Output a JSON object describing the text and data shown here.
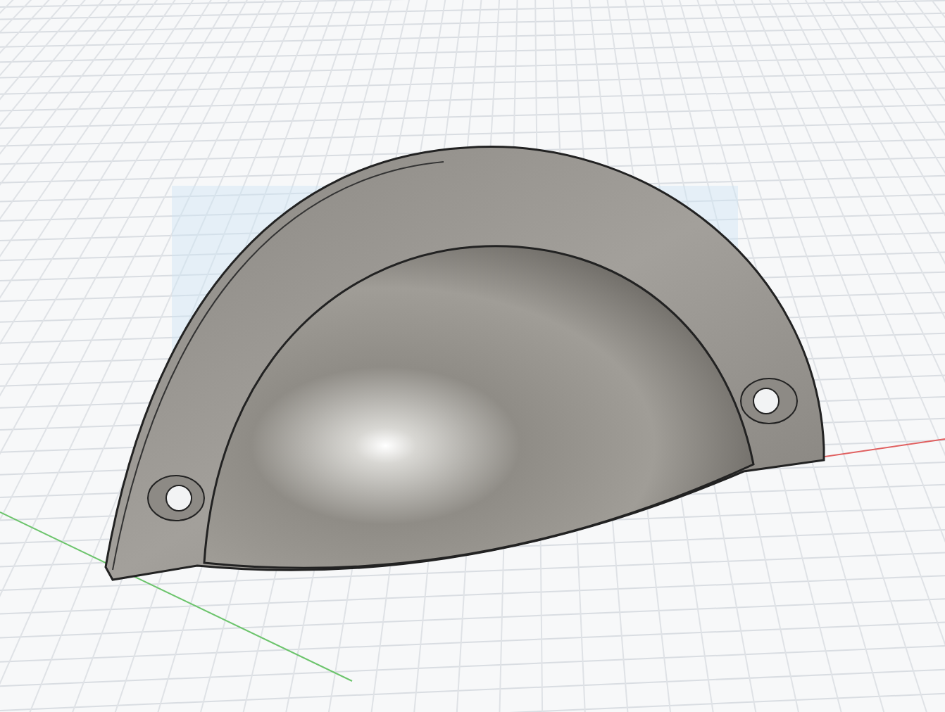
{
  "viewport": {
    "grid": true,
    "axes": true,
    "sketch_plane": true
  }
}
